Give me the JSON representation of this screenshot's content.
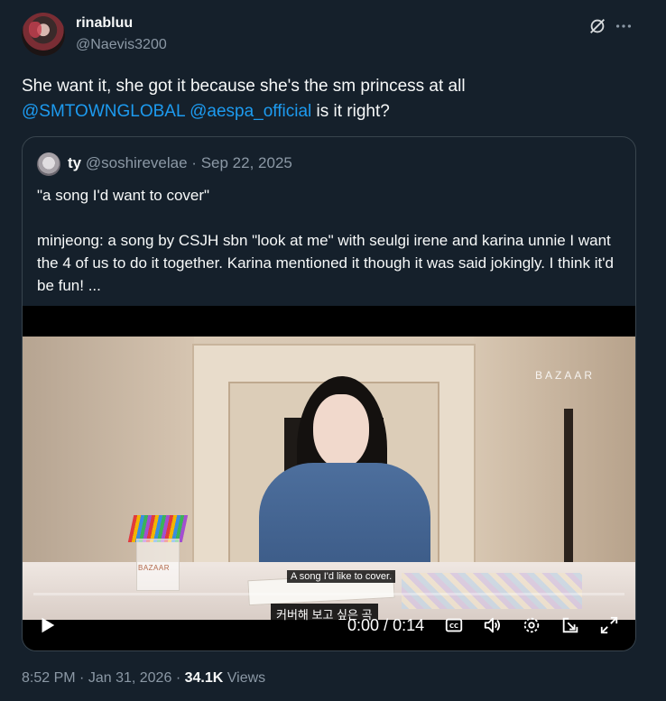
{
  "author": {
    "display_name": "rinabluu",
    "handle": "@Naevis3200",
    "avatar_icon": "profile-avatar"
  },
  "header_icons": {
    "grok": "grok-icon",
    "more": "more-icon"
  },
  "tweet": {
    "text_part1": "She want it, she got it because she's the sm princess at all",
    "mention1": "@SMTOWNGLOBAL",
    "mention2": "@aespa_official",
    "text_part2": "is it right?"
  },
  "quote": {
    "display_name": "ty",
    "handle": "@soshirevelae",
    "separator": "·",
    "date": "Sep 22, 2025",
    "line1": "\"a song I'd want to cover\"",
    "line2": "minjeong: a song by CSJH sbn \"look at me\" with seulgi irene and karina unnie I want the 4 of us to do it together. Karina mentioned it though it was said jokingly. I think it'd be fun! ..."
  },
  "video": {
    "watermark": "BAZAAR",
    "cup_label": "BAZAAR",
    "subtitle_en": "A song I'd like to cover.",
    "subtitle_ko": "커버해 보고 싶은 곡",
    "current_time": "0:00",
    "separator": "/",
    "duration": "0:14",
    "progress": 0,
    "controls": [
      "play-icon",
      "captions-icon",
      "volume-icon",
      "settings-icon",
      "pop-out-icon",
      "fullscreen-icon"
    ]
  },
  "footer": {
    "time": "8:52 PM",
    "separator": "·",
    "date": "Jan 31, 2026",
    "views_count": "34.1K",
    "views_label": "Views"
  },
  "colors": {
    "background": "#15202b",
    "accent": "#1d9bf0",
    "secondary_text": "#8b98a5",
    "border": "#38444d"
  }
}
